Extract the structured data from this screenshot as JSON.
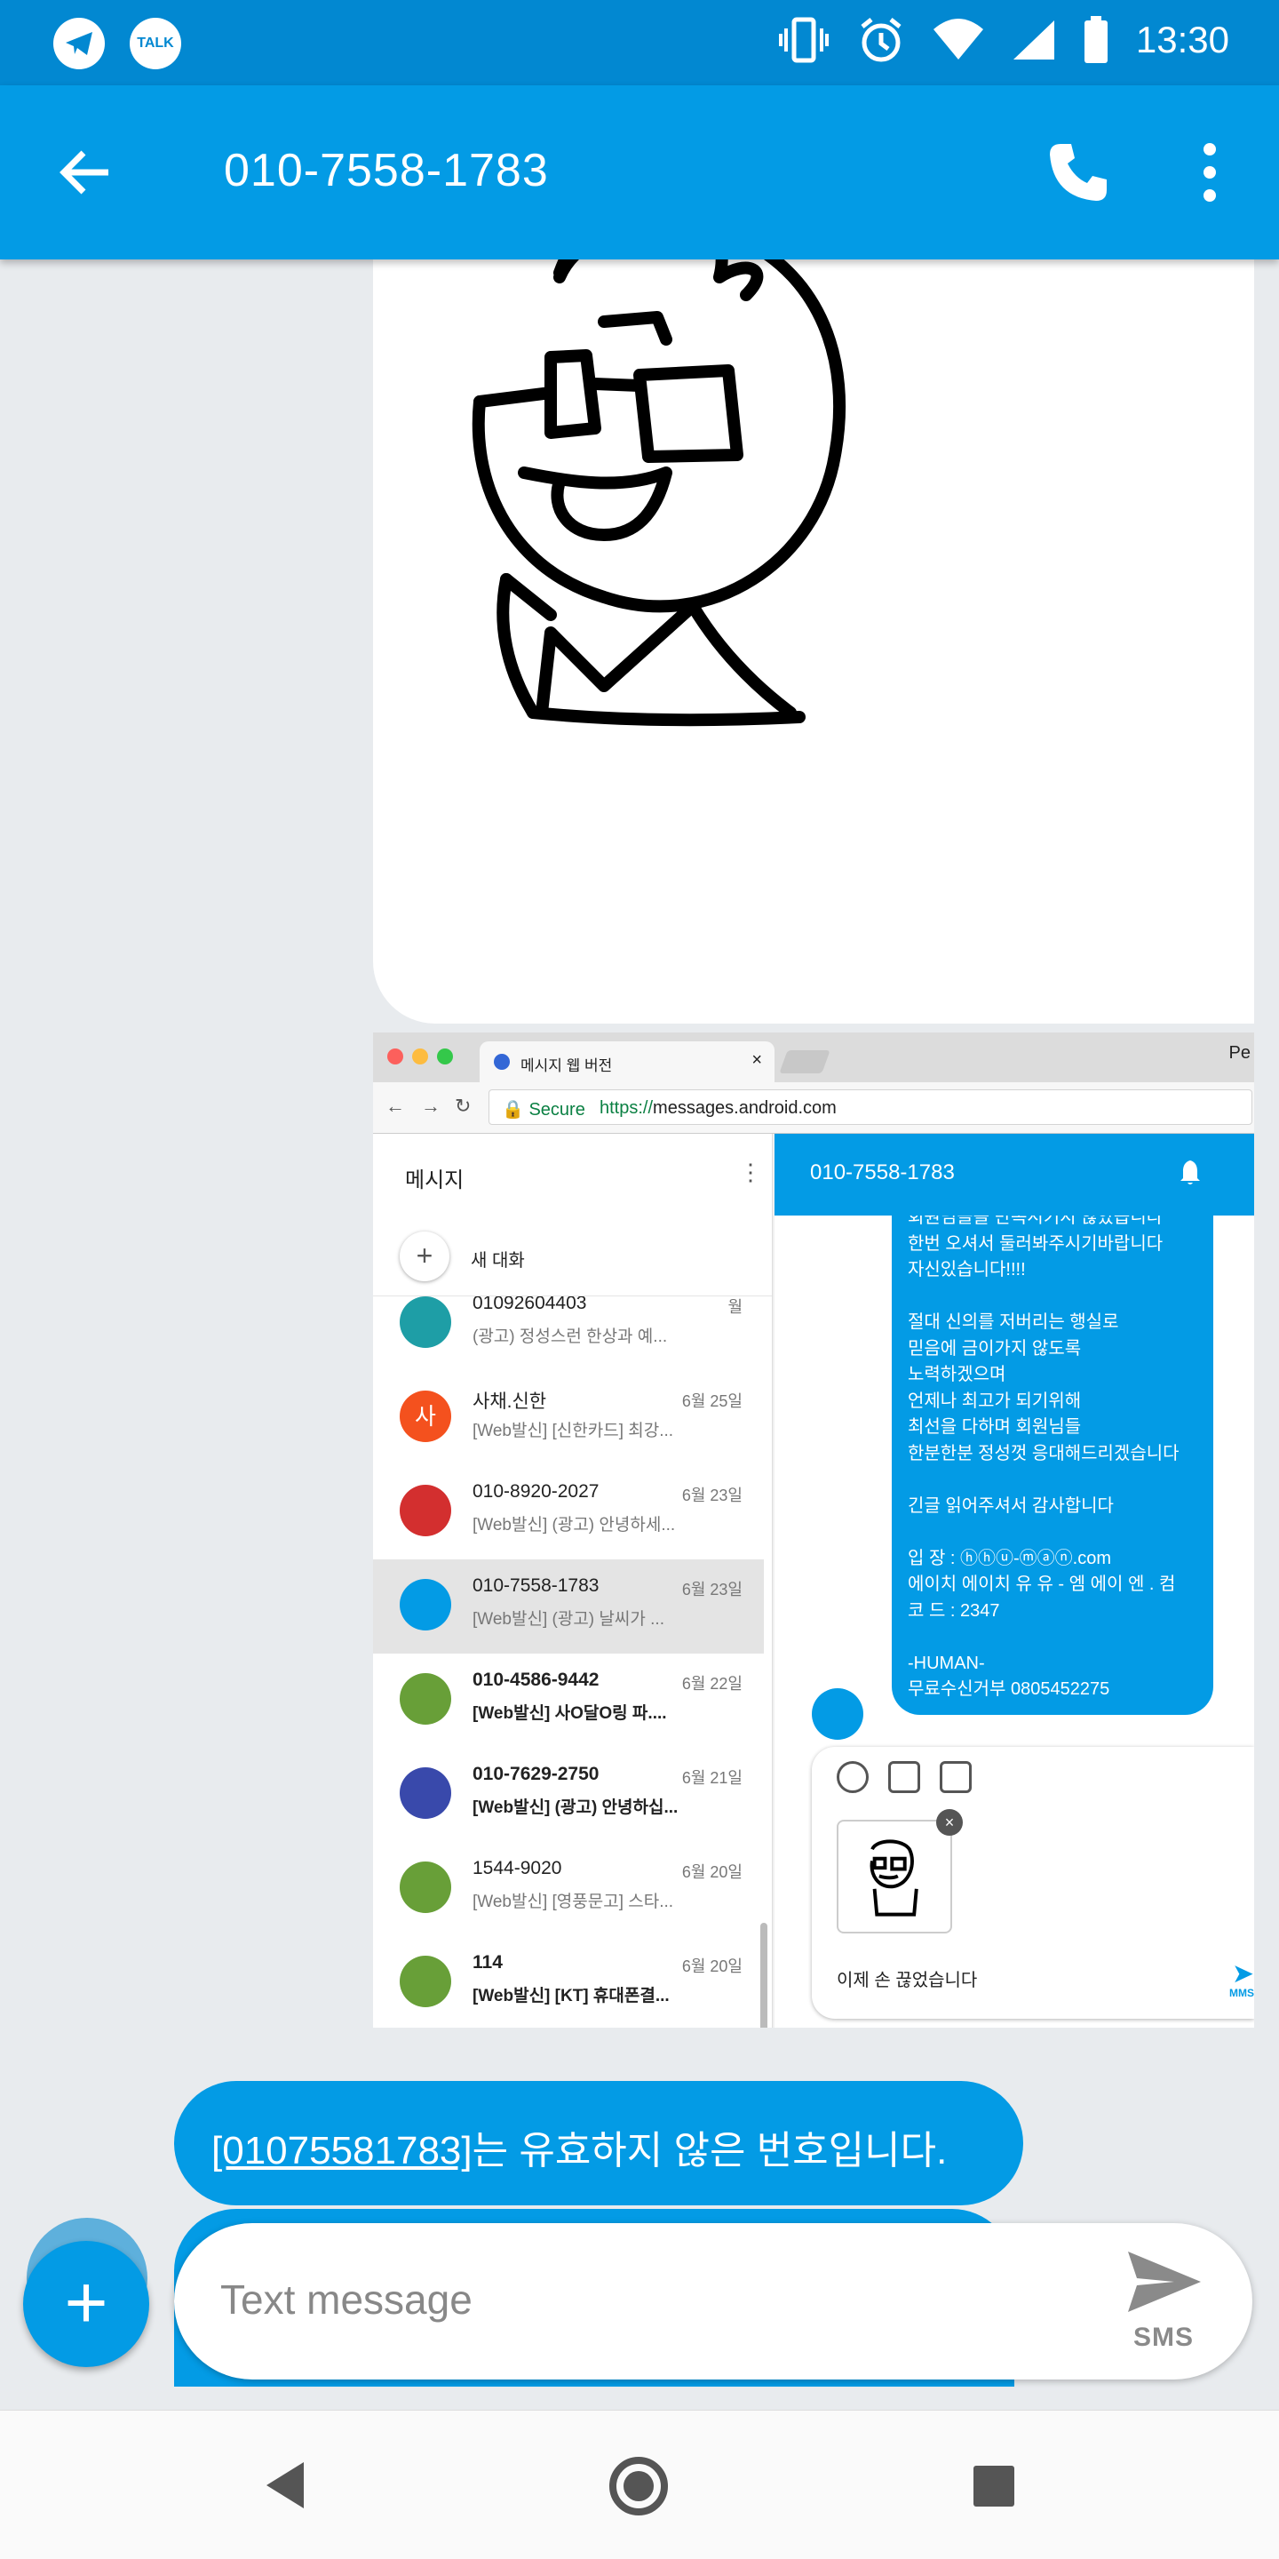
{
  "status_bar": {
    "time": "13:30",
    "notification_icons": [
      "telegram-icon",
      "kakaotalk-icon"
    ],
    "talk_badge": "TALK",
    "system_icons": [
      "vibrate-icon",
      "alarm-icon",
      "wifi-icon",
      "signal-icon",
      "battery-icon"
    ]
  },
  "app_bar": {
    "title": "010-7558-1783",
    "actions": [
      "call-icon",
      "more-vert-icon"
    ]
  },
  "shared_screenshot": {
    "tab_title": "메시지 웹 버전",
    "tab_close": "×",
    "edge_text": "Pe",
    "nav_back": "←",
    "nav_forward": "→",
    "nav_reload": "↻",
    "secure_label": "🔒 Secure",
    "url_proto": "https://",
    "url_rest": "messages.android.com",
    "left_pane": {
      "title": "메시지",
      "more": "⋮",
      "new_conversation_icon": "+",
      "new_conversation": "새 대화",
      "conversations": [
        {
          "name": "01092604403",
          "preview": "(광고) 정성스런 한상과 예...",
          "date": "월",
          "avatar_color": "#1e9ea6",
          "avatar": "",
          "bold": false,
          "selected": false
        },
        {
          "name": "사채.신한",
          "preview": "[Web발신] [신한카드] 최강...",
          "date": "6월 25일",
          "avatar_color": "#f4511e",
          "avatar": "사",
          "bold": false,
          "selected": false
        },
        {
          "name": "010-8920-2027",
          "preview": "[Web발신] (광고) 안녕하세...",
          "date": "6월 23일",
          "avatar_color": "#d32f2f",
          "avatar": "",
          "bold": false,
          "selected": false
        },
        {
          "name": "010-7558-1783",
          "preview": "[Web발신] (광고) 날씨가 ...",
          "date": "6월 23일",
          "avatar_color": "#039be5",
          "avatar": "",
          "bold": false,
          "selected": true
        },
        {
          "name": "010-4586-9442",
          "preview": "[Web발신] 사O달O링 파....",
          "date": "6월 22일",
          "avatar_color": "#689f38",
          "avatar": "",
          "bold": true,
          "selected": false
        },
        {
          "name": "010-7629-2750",
          "preview": "[Web발신] (광고) 안녕하십...",
          "date": "6월 21일",
          "avatar_color": "#3949ab",
          "avatar": "",
          "bold": true,
          "selected": false
        },
        {
          "name": "1544-9020",
          "preview": "[Web발신] [영풍문고] 스타...",
          "date": "6월 20일",
          "avatar_color": "#689f38",
          "avatar": "",
          "bold": false,
          "selected": false
        },
        {
          "name": "114",
          "preview": "[Web발신] [KT] 휴대폰결...",
          "date": "6월 20일",
          "avatar_color": "#689f38",
          "avatar": "",
          "bold": true,
          "selected": false
        }
      ]
    },
    "right_pane": {
      "title": "010-7558-1783",
      "message_lines": [
        "회원님들을 만족시키지 않았습니다",
        "한번 오셔서 둘러봐주시기바랍니다",
        "자신있습니다!!!!",
        "",
        "절대 신의를 저버리는 행실로",
        "믿음에 금이가지 않도록",
        "노력하겠으며",
        "언제나 최고가 되기위해",
        "최선을 다하며 회원님들",
        "한분한분 정성껏 응대해드리겠습니다",
        "",
        "긴글 읽어주셔서 감사합니다",
        "",
        "입 장 : ⓗⓗⓤ-ⓜⓐⓝ.com",
        "  에이치 에이치 유 유 - 엠 에이 엔 . 컴",
        "코 드 : 2347",
        "",
        "-HUMAN-",
        "무료수신거부 0805452275"
      ],
      "composer_text": "이제 손 끊었습니다",
      "attachment_remove": "×",
      "send_icon": "➤",
      "send_label": "MMS"
    }
  },
  "sms_bubbles": {
    "number_link": "[01075581783]",
    "invalid_text": "는 유효하지 않은 번호입니다."
  },
  "fab_label": "+",
  "compose": {
    "placeholder": "Text message",
    "value": "",
    "send_label": "SMS"
  },
  "nav_bar": [
    "back-icon",
    "home-icon",
    "recents-icon"
  ]
}
